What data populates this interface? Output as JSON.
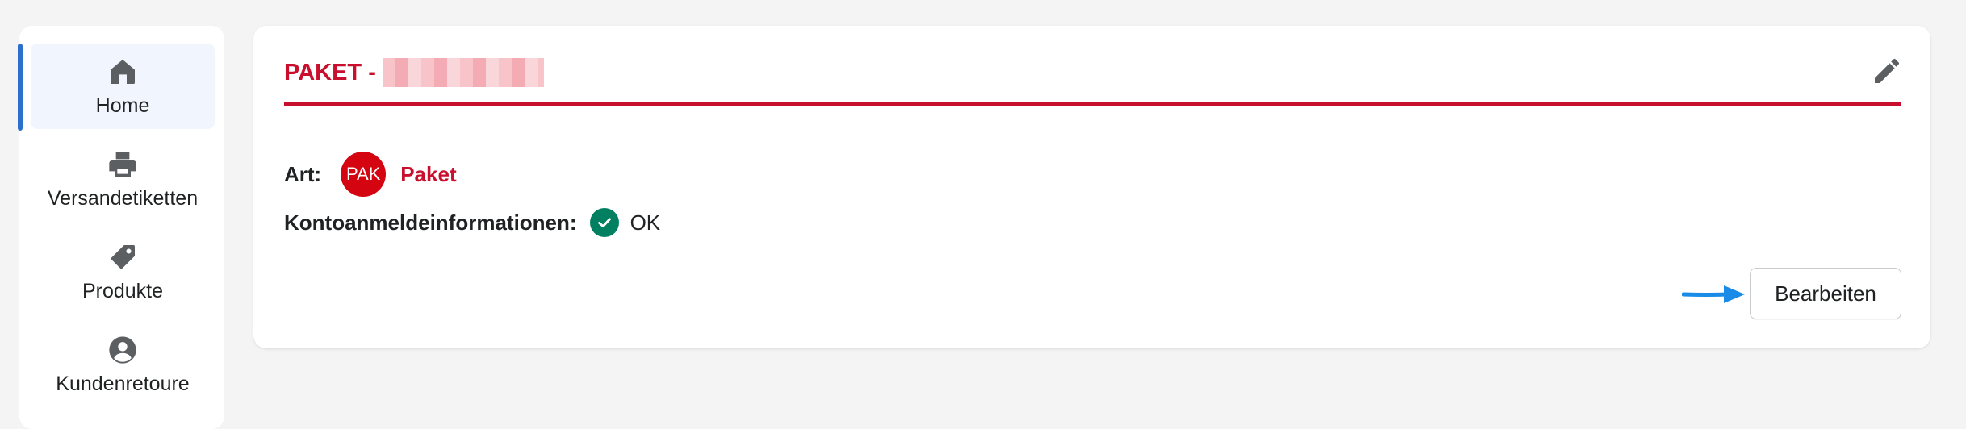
{
  "sidebar": {
    "items": [
      {
        "label": "Home",
        "icon": "home-icon",
        "active": true
      },
      {
        "label": "Versandetiketten",
        "icon": "printer-icon",
        "active": false
      },
      {
        "label": "Produkte",
        "icon": "tag-icon",
        "active": false
      },
      {
        "label": "Kundenretoure",
        "icon": "account-circle-icon",
        "active": false
      }
    ]
  },
  "card": {
    "title_prefix": "PAKET -",
    "edit_icon": "pencil-icon",
    "art_label": "Art:",
    "art_badge": "PAK",
    "art_value": "Paket",
    "credentials_label": "Kontoanmeldeinformationen:",
    "credentials_status_icon": "check-circle-icon",
    "credentials_status": "OK",
    "edit_button_label": "Bearbeiten"
  },
  "colors": {
    "brand_red": "#c8102e",
    "badge_red": "#d40511",
    "success_green": "#008060",
    "nav_active_indicator": "#2c6ecb",
    "nav_active_bg": "#f1f6fe",
    "annotation_arrow": "#1a8be6"
  }
}
